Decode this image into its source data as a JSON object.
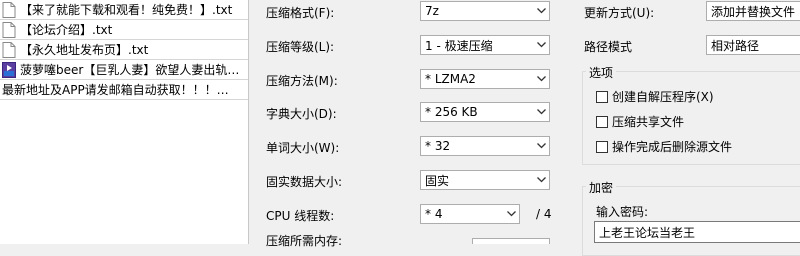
{
  "files": [
    {
      "name": "【来了就能下载和观看！纯免费！】.txt",
      "icon": "text-file-icon"
    },
    {
      "name": "【论坛介绍】.txt",
      "icon": "text-file-icon"
    },
    {
      "name": "【永久地址发布页】.txt",
      "icon": "text-file-icon"
    },
    {
      "name": "菠萝噻beer【巨乳人妻】欲望人妻出轨…",
      "icon": "media-file-icon"
    },
    {
      "name": "最新地址及APP请发邮箱自动获取！！！…",
      "icon": ""
    }
  ],
  "settings": {
    "format_label": "压缩格式(F):",
    "format_value": "7z",
    "level_label": "压缩等级(L):",
    "level_value": "1 - 极速压缩",
    "method_label": "压缩方法(M):",
    "method_value": "* LZMA2",
    "dict_label": "字典大小(D):",
    "dict_value": "* 256 KB",
    "word_label": "单词大小(W):",
    "word_value": "* 32",
    "solid_label": "固实数据大小:",
    "solid_value": "固实",
    "threads_label": "CPU 线程数:",
    "threads_value": "* 4",
    "threads_total": "/ 4",
    "memory_label": "压缩所需内存:"
  },
  "right": {
    "update_label": "更新方式(U):",
    "update_value": "添加并替换文件",
    "path_label": "路径模式",
    "path_value": "相对路径",
    "options_title": "选项",
    "opt_sfx": "创建自解压程序(X)",
    "opt_shared": "压缩共享文件",
    "opt_delete": "操作完成后删除源文件",
    "encrypt_title": "加密",
    "password_label": "输入密码:",
    "password_value": "上老王论坛当老王"
  }
}
